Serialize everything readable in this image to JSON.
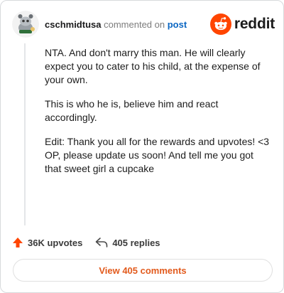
{
  "header": {
    "username": "cschmidtusa",
    "action": "commented on",
    "target": "post",
    "brand": "reddit",
    "avatar_icon": "snoo-avatar-icon",
    "logo_icon": "reddit-logo-icon"
  },
  "comment": {
    "paragraphs": [
      "NTA. And don't marry this man. He will clearly expect you to cater to his child, at the expense of your own.",
      "This is who he is, believe him and react accordingly.",
      "Edit: Thank you all for the rewards and upvotes! <3\nOP, please update us soon! And tell me you got that sweet girl a cupcake"
    ]
  },
  "stats": {
    "upvotes": "36K upvotes",
    "replies": "405 replies",
    "upvote_icon": "upvote-arrow-icon",
    "reply_icon": "reply-arrow-icon"
  },
  "view_button": "View 405 comments",
  "colors": {
    "upvote": "#ff4500",
    "link": "#0a66c2",
    "view_button_text": "#e25a1c",
    "border": "#d7dadc"
  }
}
